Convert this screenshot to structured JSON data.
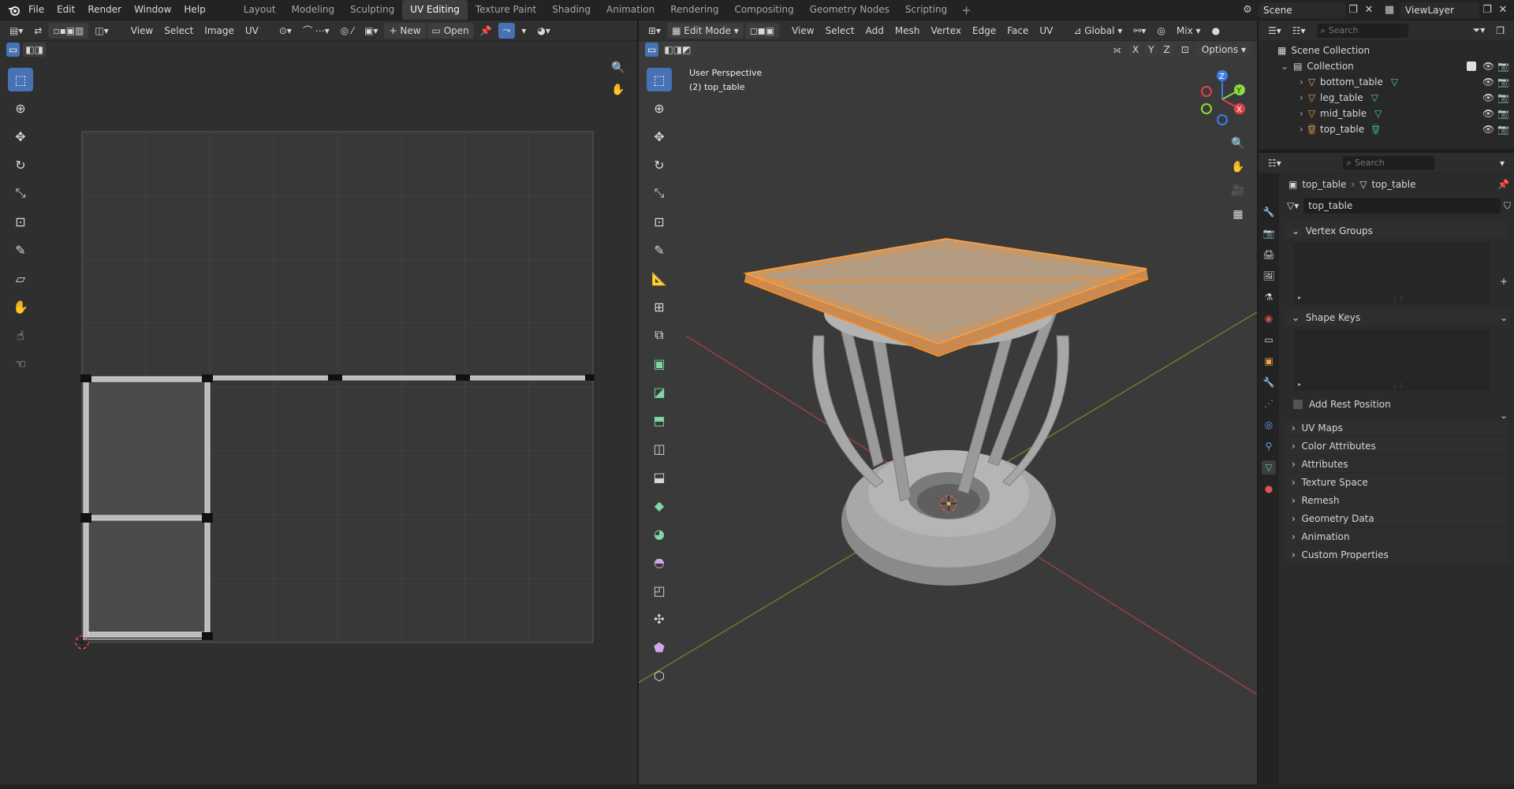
{
  "topbar": {
    "menus": [
      "File",
      "Edit",
      "Render",
      "Window",
      "Help"
    ],
    "workspaces": [
      "Layout",
      "Modeling",
      "Sculpting",
      "UV Editing",
      "Texture Paint",
      "Shading",
      "Animation",
      "Rendering",
      "Compositing",
      "Geometry Nodes",
      "Scripting"
    ],
    "active_workspace": "UV Editing",
    "scene_label": "Scene",
    "viewlayer_label": "ViewLayer"
  },
  "uv_editor": {
    "menus": [
      "View",
      "Select",
      "Image",
      "UV"
    ],
    "new_label": "New",
    "open_label": "Open"
  },
  "viewport": {
    "mode_label": "Edit Mode",
    "menus": [
      "View",
      "Select",
      "Add",
      "Mesh",
      "Vertex",
      "Edge",
      "Face",
      "UV"
    ],
    "orientation_label": "Global",
    "blend_label": "Mix",
    "options_label": "Options",
    "axes": [
      "X",
      "Y",
      "Z"
    ],
    "info_line1": "User Perspective",
    "info_line2": "(2) top_table"
  },
  "outliner": {
    "search_placeholder": "Search",
    "root_label": "Scene Collection",
    "collection_label": "Collection",
    "objects": [
      "bottom_table",
      "leg_table",
      "mid_table",
      "top_table"
    ]
  },
  "properties": {
    "search_placeholder": "Search",
    "breadcrumb_object": "top_table",
    "breadcrumb_data": "top_table",
    "data_name_value": "top_table",
    "panels": {
      "vertex_groups": "Vertex Groups",
      "shape_keys": "Shape Keys",
      "add_rest_position": "Add Rest Position",
      "uv_maps": "UV Maps",
      "color_attributes": "Color Attributes",
      "attributes": "Attributes",
      "texture_space": "Texture Space",
      "remesh": "Remesh",
      "geometry_data": "Geometry Data",
      "animation": "Animation",
      "custom_properties": "Custom Properties"
    }
  },
  "colors": {
    "accent": "#4772b3",
    "selection": "#ff8c1a",
    "axis_x": "#e2424a",
    "axis_y": "#8bdc3c",
    "axis_z": "#3b7ee8"
  }
}
